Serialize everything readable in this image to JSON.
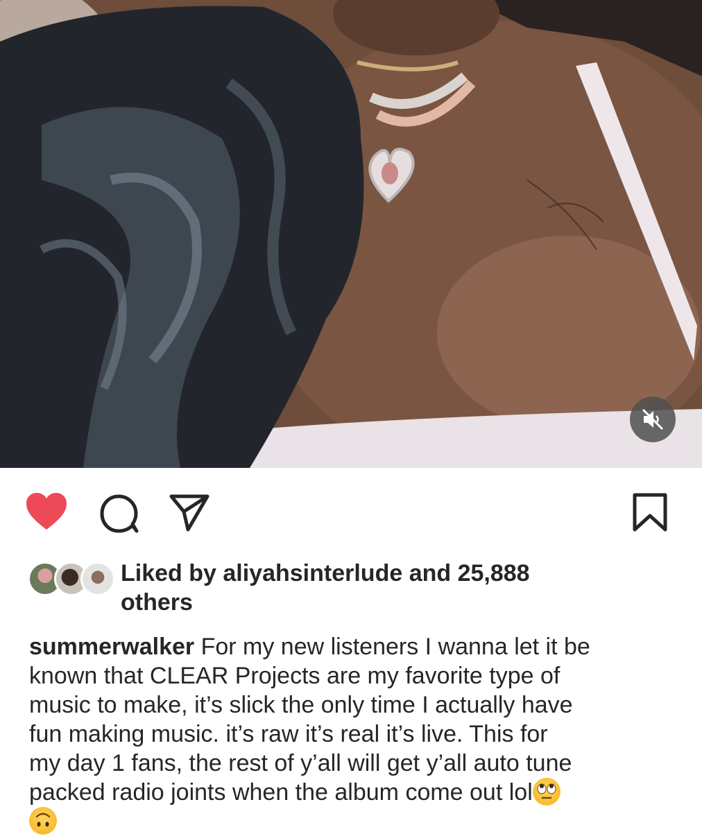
{
  "media": {
    "alt_icon": "muted-speaker-icon"
  },
  "actions": {
    "like_icon": "heart-filled-icon",
    "comment_icon": "comment-bubble-icon",
    "share_icon": "paper-plane-icon",
    "save_icon": "bookmark-icon",
    "like_color": "#ed4956"
  },
  "likes": {
    "prefix": "Liked by ",
    "user": "aliyahsinterlude",
    "middle": " and ",
    "count": "25,888",
    "suffix_line": "others"
  },
  "caption": {
    "username": "summerwalker",
    "line1": " For my new listeners I wanna let it be",
    "line2": "known that CLEAR Projects are my favorite type of",
    "line3": "music to make, it’s slick the only time I actually have",
    "line4": "fun making music. it’s raw it’s real it’s live. This for",
    "line5": "my day 1 fans, the rest of y’all will get y’all auto tune",
    "line6": "packed radio joints when the album come out lol",
    "emoji1": "eye-roll-emoji",
    "emoji2": "upside-down-face-emoji"
  }
}
